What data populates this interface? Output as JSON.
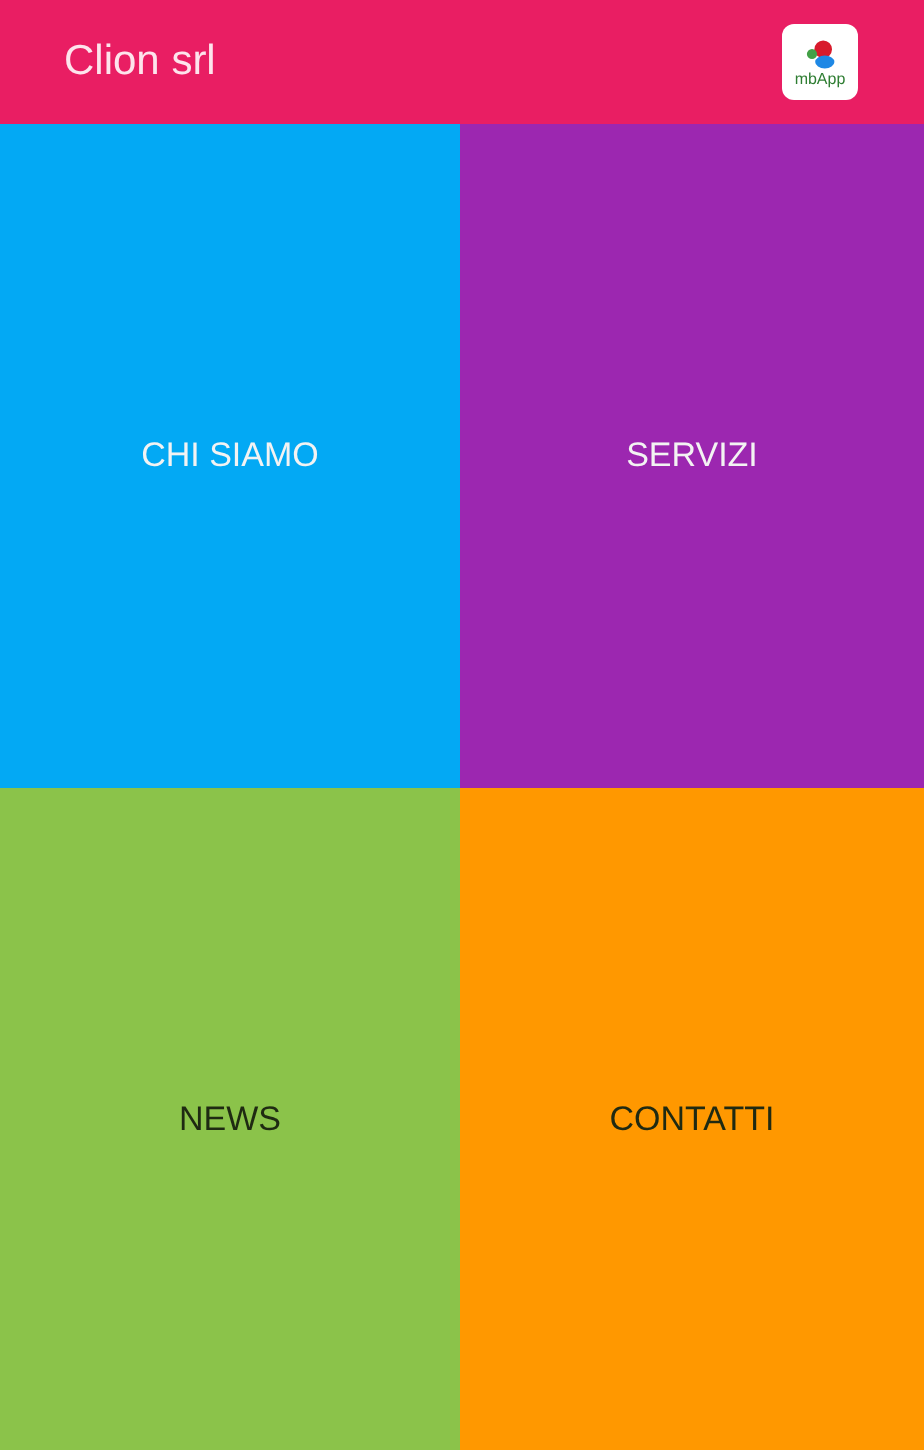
{
  "app_bar": {
    "title": "Clion srl",
    "logo_text": "mbApp"
  },
  "tiles": [
    {
      "label": "CHI SIAMO",
      "color": "#03a9f4"
    },
    {
      "label": "SERVIZI",
      "color": "#9c27b0"
    },
    {
      "label": "NEWS",
      "color": "#8bc34a"
    },
    {
      "label": "CONTATTI",
      "color": "#ff9800"
    }
  ]
}
